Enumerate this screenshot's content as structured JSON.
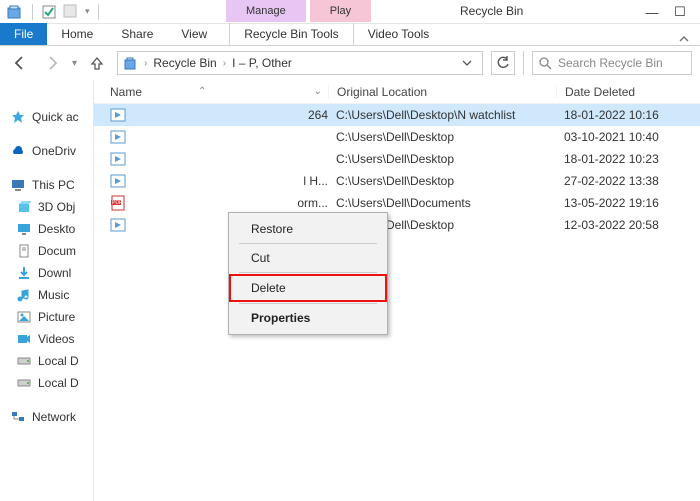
{
  "window": {
    "title": "Recycle Bin",
    "min": "—",
    "max": "☐",
    "close": ""
  },
  "ribbon": {
    "file": "File",
    "tabs": [
      "Home",
      "Share",
      "View"
    ],
    "context_groups": [
      {
        "head": "Manage",
        "sub": "Recycle Bin Tools"
      },
      {
        "head": "Play",
        "sub": "Video Tools"
      }
    ]
  },
  "breadcrumb": {
    "parts": [
      "Recycle Bin",
      "I – P, Other"
    ]
  },
  "search": {
    "placeholder": "Search Recycle Bin"
  },
  "sidebar": {
    "quick": "Quick ac",
    "onedrive": "OneDriv",
    "thispc": "This PC",
    "items": [
      "3D Obj",
      "Deskto",
      "Docum",
      "Downl",
      "Music",
      "Picture",
      "Videos",
      "Local D",
      "Local D"
    ],
    "network": "Network"
  },
  "columns": {
    "name": "Name",
    "orig": "Original Location",
    "date": "Date Deleted"
  },
  "rows": [
    {
      "icon": "video",
      "name": "264",
      "orig": "C:\\Users\\Dell\\Desktop\\N watchlist",
      "date": "18-01-2022 10:16",
      "selected": true
    },
    {
      "icon": "video",
      "name": "",
      "orig": "C:\\Users\\Dell\\Desktop",
      "date": "03-10-2021 10:40"
    },
    {
      "icon": "video",
      "name": "",
      "orig": "C:\\Users\\Dell\\Desktop",
      "date": "18-01-2022 10:23"
    },
    {
      "icon": "video",
      "name": "l H...",
      "orig": "C:\\Users\\Dell\\Desktop",
      "date": "27-02-2022 13:38"
    },
    {
      "icon": "pdf",
      "name": "orm...",
      "orig": "C:\\Users\\Dell\\Documents",
      "date": "13-05-2022 19:16"
    },
    {
      "icon": "video",
      "name": "",
      "orig": "C:\\Users\\Dell\\Desktop",
      "date": "12-03-2022 20:58"
    }
  ],
  "context_menu": {
    "items": [
      "Restore",
      "Cut",
      "Delete",
      "Properties"
    ],
    "highlighted": 2,
    "bold": 3
  }
}
